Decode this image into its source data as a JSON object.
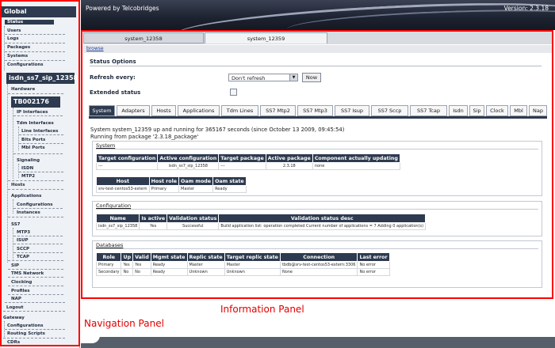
{
  "header": {
    "powered_by": "Powered by Telcobridges",
    "version": "Version: 2.3.18"
  },
  "sidebar": {
    "global_title": "Global",
    "status": "Status",
    "users": "Users",
    "logs": "Logs",
    "packages": "Packages",
    "systems": "Systems",
    "configurations": "Configurations",
    "system_name": "isdn_ss7_sip_12358",
    "hardware": "Hardware",
    "device_name": "TB002176",
    "ip_interfaces": "IP Interfaces",
    "tdm_interfaces": "Tdm Interfaces",
    "line_interfaces": "Line Interfaces",
    "bits_ports": "Bits Ports",
    "mbl_ports": "Mbl Ports",
    "signaling": "Signaling",
    "isdn": "ISDN",
    "mtp2": "MTP2",
    "hosts": "Hosts",
    "applications": "Applications",
    "app_configurations": "Configurations",
    "instances": "Instances",
    "ss7": "SS7",
    "ss7_mtp3": "MTP3",
    "ss7_isup": "ISUP",
    "ss7_sccp": "SCCP",
    "ss7_tcap": "TCAP",
    "sip": "SIP",
    "tms_network": "TMS Network",
    "clocking": "Clocking",
    "profiles": "Profiles",
    "nap": "NAP",
    "logout": "Logout",
    "gateway": "Gateway",
    "gw_configurations": "Configurations",
    "routing_scripts": "Routing Scripts",
    "cdrs": "CDRs"
  },
  "annotations": {
    "navigation_panel": "Navigation Panel",
    "information_panel": "Information Panel"
  },
  "top_tabs": [
    "system_12358",
    "system_12359"
  ],
  "browse": "browse",
  "status_options": {
    "title": "Status Options",
    "refresh_label": "Refresh every:",
    "refresh_value": "Don't refresh",
    "now_button": "Now",
    "extended_label": "Extended status",
    "extended_checked": false
  },
  "tabs": [
    "System",
    "Adapters",
    "Hosts",
    "Applications",
    "Tdm Lines",
    "SS7 Mtp2",
    "SS7 Mtp3",
    "SS7 Isup",
    "SS7 Sccp",
    "SS7 Tcap",
    "Isdn",
    "Sip",
    "Clock",
    "Mbl",
    "Nap"
  ],
  "active_tab": "System",
  "system": {
    "running_text": "System system_12359 up and running for 365167 seconds (since October 13 2009, 09:45:54)",
    "package_text": "Running from package '2.3.18_package'",
    "section_title": "System",
    "sys_headers": [
      "Target configuration",
      "Active configuration",
      "Target package",
      "Active package",
      "Component actually updating"
    ],
    "sys_row": [
      "---",
      "isdn_ss7_sip_12358",
      "---",
      "2.3.18",
      "none"
    ],
    "host_headers": [
      "Host",
      "Host role",
      "Oam mode",
      "Oam state"
    ],
    "host_row": [
      "srv-test-centos53-extern",
      "Primary",
      "Master",
      "Ready"
    ]
  },
  "configuration": {
    "section_title": "Configuration",
    "headers": [
      "Name",
      "Is active",
      "Validation status",
      "Validation status desc"
    ],
    "row": [
      "isdn_ss7_sip_12358",
      "Yes",
      "Successful",
      "Build application list: operation completed Current number of applications = 7 Adding 0 application(s)"
    ]
  },
  "databases": {
    "section_title": "Databases",
    "headers": [
      "Role",
      "Up",
      "Valid",
      "Mgmt state",
      "Replic state",
      "Target replic state",
      "Connection",
      "Last error"
    ],
    "rows": [
      [
        "Primary",
        "Yes",
        "Yes",
        "Ready",
        "Master",
        "Master",
        "tbdb@srv-test-centos53-extern:3306",
        "No error"
      ],
      [
        "Secondary",
        "No",
        "No",
        "Ready",
        "Unknown",
        "Unknown",
        "None",
        "No error"
      ]
    ]
  }
}
